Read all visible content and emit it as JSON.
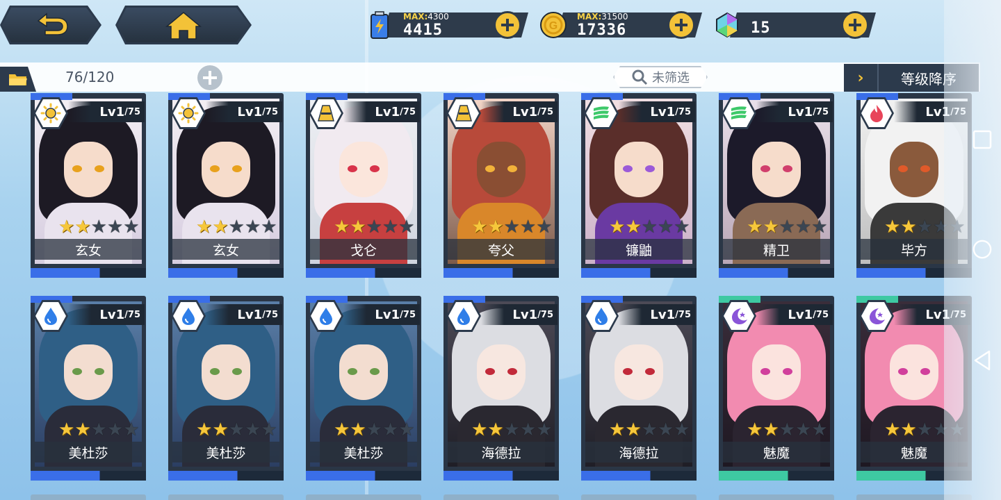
{
  "topbar": {
    "back_icon": "back-arrow-icon",
    "home_icon": "home-icon",
    "resources": [
      {
        "name": "energy",
        "icon": "battery-icon",
        "max_label": "MAX:",
        "max_value": "4300",
        "value": "4415"
      },
      {
        "name": "gold",
        "icon": "gold-coin-icon",
        "max_label": "MAX:",
        "max_value": "31500",
        "value": "17336"
      },
      {
        "name": "crystal",
        "icon": "crystal-icon",
        "max_label": "",
        "max_value": "",
        "value": "15"
      }
    ]
  },
  "filterbar": {
    "count": "76/120",
    "filter_label": "未筛选",
    "sort_label": "等级降序"
  },
  "colors": {
    "blue_accent": "#3a6ee8",
    "green_accent": "#3ec9a2",
    "gold_star": "#f6c73b",
    "dark_panel": "#2c3a4c"
  },
  "cards": [
    {
      "level": "Lv1",
      "max": "/75",
      "name": "玄女",
      "element": "sun-icon",
      "stars": 2,
      "accent": "blue"
    },
    {
      "level": "Lv1",
      "max": "/75",
      "name": "玄女",
      "element": "sun-icon",
      "stars": 2,
      "accent": "blue"
    },
    {
      "level": "Lv1",
      "max": "/75",
      "name": "戈仑",
      "element": "earth-icon",
      "stars": 2,
      "accent": "blue"
    },
    {
      "level": "Lv1",
      "max": "/75",
      "name": "夸父",
      "element": "earth-icon",
      "stars": 2,
      "accent": "blue"
    },
    {
      "level": "Lv1",
      "max": "/75",
      "name": "镰鼬",
      "element": "wind-icon",
      "stars": 2,
      "accent": "blue"
    },
    {
      "level": "Lv1",
      "max": "/75",
      "name": "精卫",
      "element": "wind-icon",
      "stars": 2,
      "accent": "blue"
    },
    {
      "level": "Lv1",
      "max": "/75",
      "name": "毕方",
      "element": "fire-icon",
      "stars": 2,
      "accent": "blue"
    },
    {
      "level": "Lv1",
      "max": "/75",
      "name": "美杜莎",
      "element": "water-icon",
      "stars": 2,
      "accent": "blue"
    },
    {
      "level": "Lv1",
      "max": "/75",
      "name": "美杜莎",
      "element": "water-icon",
      "stars": 2,
      "accent": "blue"
    },
    {
      "level": "Lv1",
      "max": "/75",
      "name": "美杜莎",
      "element": "water-icon",
      "stars": 2,
      "accent": "blue"
    },
    {
      "level": "Lv1",
      "max": "/75",
      "name": "海德拉",
      "element": "water-icon",
      "stars": 2,
      "accent": "blue"
    },
    {
      "level": "Lv1",
      "max": "/75",
      "name": "海德拉",
      "element": "water-icon",
      "stars": 2,
      "accent": "blue"
    },
    {
      "level": "Lv1",
      "max": "/75",
      "name": "魅魔",
      "element": "moon-icon",
      "stars": 2,
      "accent": "green"
    },
    {
      "level": "Lv1",
      "max": "/75",
      "name": "魅魔",
      "element": "moon-icon",
      "stars": 2,
      "accent": "green"
    }
  ],
  "android_nav": [
    "recent-apps-icon",
    "home-circle-icon",
    "back-triangle-icon"
  ]
}
